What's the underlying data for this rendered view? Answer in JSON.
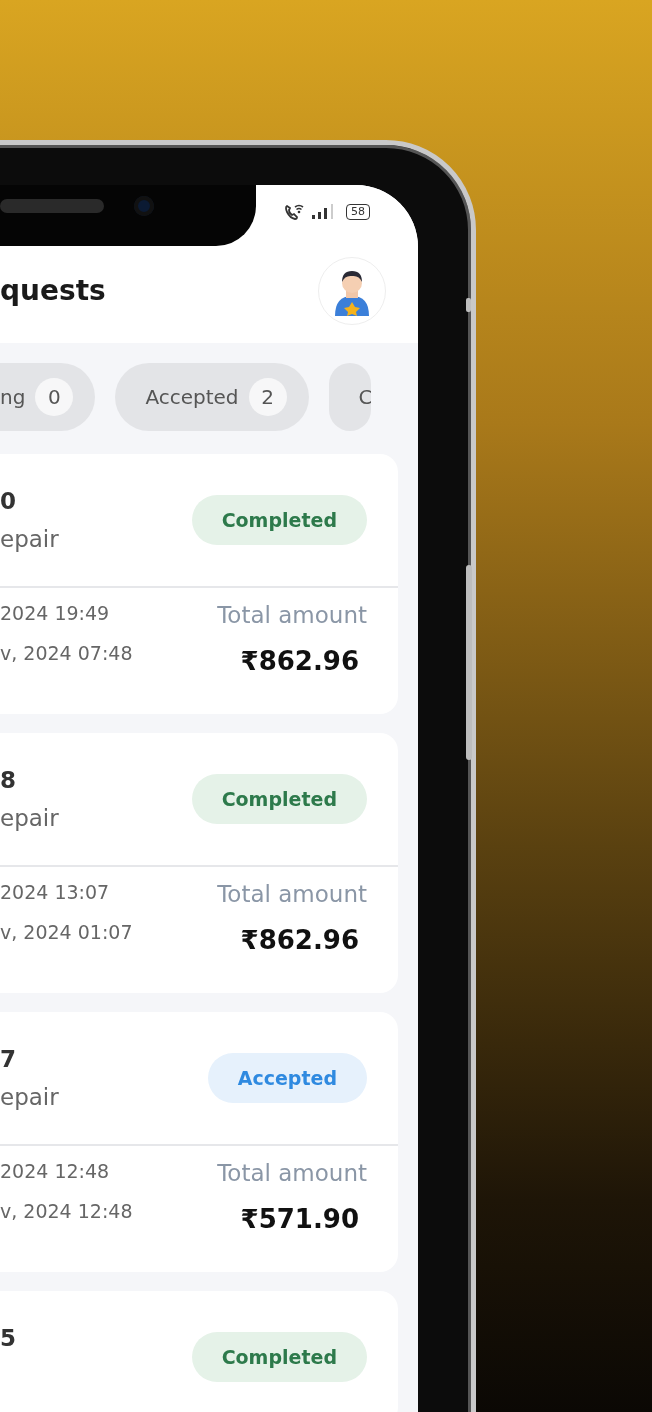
{
  "status_bar": {
    "battery": "58"
  },
  "header": {
    "title": "quests"
  },
  "filters": [
    {
      "label": "ng",
      "count": "0"
    },
    {
      "label": "Accepted",
      "count": "2"
    },
    {
      "label": "C"
    }
  ],
  "requests": [
    {
      "id": "0",
      "service": "epair",
      "status": "Completed",
      "kind": "completed",
      "date_1": "2024 19:49",
      "date_2": "v, 2024 07:48",
      "amount_label": "Total amount",
      "amount": "₹862.96"
    },
    {
      "id": "8",
      "service": "epair",
      "status": "Completed",
      "kind": "completed",
      "date_1": "2024 13:07",
      "date_2": "v, 2024 01:07",
      "amount_label": "Total amount",
      "amount": "₹862.96"
    },
    {
      "id": "7",
      "service": "epair",
      "status": "Accepted",
      "kind": "accepted",
      "date_1": "2024 12:48",
      "date_2": "v, 2024 12:48",
      "amount_label": "Total amount",
      "amount": "₹571.90"
    },
    {
      "id": "5",
      "status": "Completed",
      "kind": "completed"
    }
  ]
}
